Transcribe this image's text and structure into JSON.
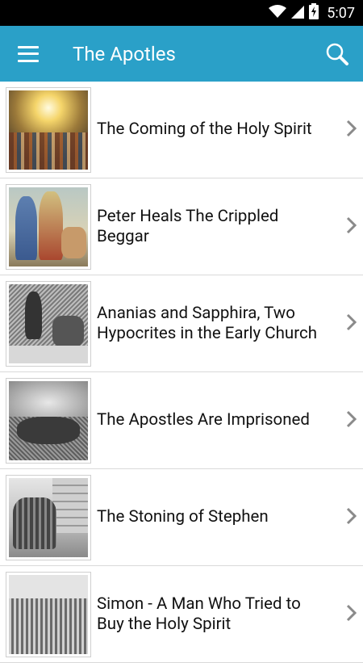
{
  "status_bar": {
    "time": "5:07"
  },
  "app_bar": {
    "title": "The Apotles"
  },
  "items": [
    {
      "label": "The Coming of the Holy Spirit",
      "thumb": "pentecost-painting"
    },
    {
      "label": "Peter Heals The Crippled Beggar",
      "thumb": "peter-healing-painting"
    },
    {
      "label": "Ananias and Sapphira, Two Hypocrites in the Early Church",
      "thumb": "ananias-engraving"
    },
    {
      "label": "The Apostles Are Imprisoned",
      "thumb": "apostles-prison-engraving"
    },
    {
      "label": "The Stoning of Stephen",
      "thumb": "stephen-stoning-engraving"
    },
    {
      "label": "Simon - A Man Who Tried to Buy the Holy Spirit",
      "thumb": "simon-magus-engraving"
    }
  ],
  "colors": {
    "app_bar": "#2aa0c8",
    "status_bar": "#000000",
    "chevron": "#8a8a8a"
  }
}
